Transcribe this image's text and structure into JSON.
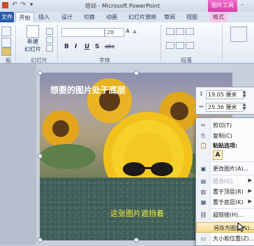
{
  "window": {
    "title": "培训 - Microsoft PowerPoint",
    "context_tab_group": "图片工具",
    "minimize_symbol": "–"
  },
  "quick_access": [
    "↶",
    "↷",
    "▾"
  ],
  "tabs": [
    {
      "label": "文件",
      "state": "file"
    },
    {
      "label": "开始",
      "state": "active"
    },
    {
      "label": "插入",
      "state": ""
    },
    {
      "label": "设计",
      "state": ""
    },
    {
      "label": "切换",
      "state": ""
    },
    {
      "label": "动画",
      "state": ""
    },
    {
      "label": "幻灯片放映",
      "state": ""
    },
    {
      "label": "审阅",
      "state": ""
    },
    {
      "label": "视图",
      "state": ""
    },
    {
      "label": "格式",
      "state": "fmt"
    }
  ],
  "ribbon": {
    "new_slide_label_1": "新建",
    "new_slide_label_2": "幻灯片",
    "group_clipboard": "板",
    "group_slides": "幻灯片",
    "group_font": "字体",
    "group_paragraph": "段落",
    "font_size": "28",
    "format_glyphs": [
      "B",
      "I",
      "U",
      "S",
      "abc"
    ]
  },
  "slide": {
    "title": "想要的图片处于底层",
    "caption": "这张图片遮挡着"
  },
  "size_bar": {
    "height_value": "19.05 厘米",
    "width_value": "25.36 厘米"
  },
  "context_menu": {
    "items": [
      {
        "label": "剪切(T)",
        "icon": "✂",
        "type": "normal"
      },
      {
        "label": "复制(C)",
        "icon": "⎘",
        "type": "normal"
      },
      {
        "label": "粘贴选项:",
        "icon": "📋",
        "type": "header"
      },
      {
        "label": "更改图片(A)...",
        "icon": "▣",
        "type": "normal"
      },
      {
        "label": "组合(G)",
        "icon": "▤",
        "type": "disabled",
        "submenu": true
      },
      {
        "label": "置于顶层(R)",
        "icon": "▥",
        "type": "normal",
        "submenu": true
      },
      {
        "label": "置于底层(K)",
        "icon": "▦",
        "type": "normal",
        "submenu": true
      },
      {
        "label": "超链接(H)...",
        "icon": "⛓",
        "type": "normal"
      },
      {
        "label": "另存为图片(S)...",
        "icon": "",
        "type": "highlight"
      },
      {
        "label": "大小和位置(Z)...",
        "icon": "▭",
        "type": "normal"
      }
    ],
    "paste_option": "A"
  }
}
